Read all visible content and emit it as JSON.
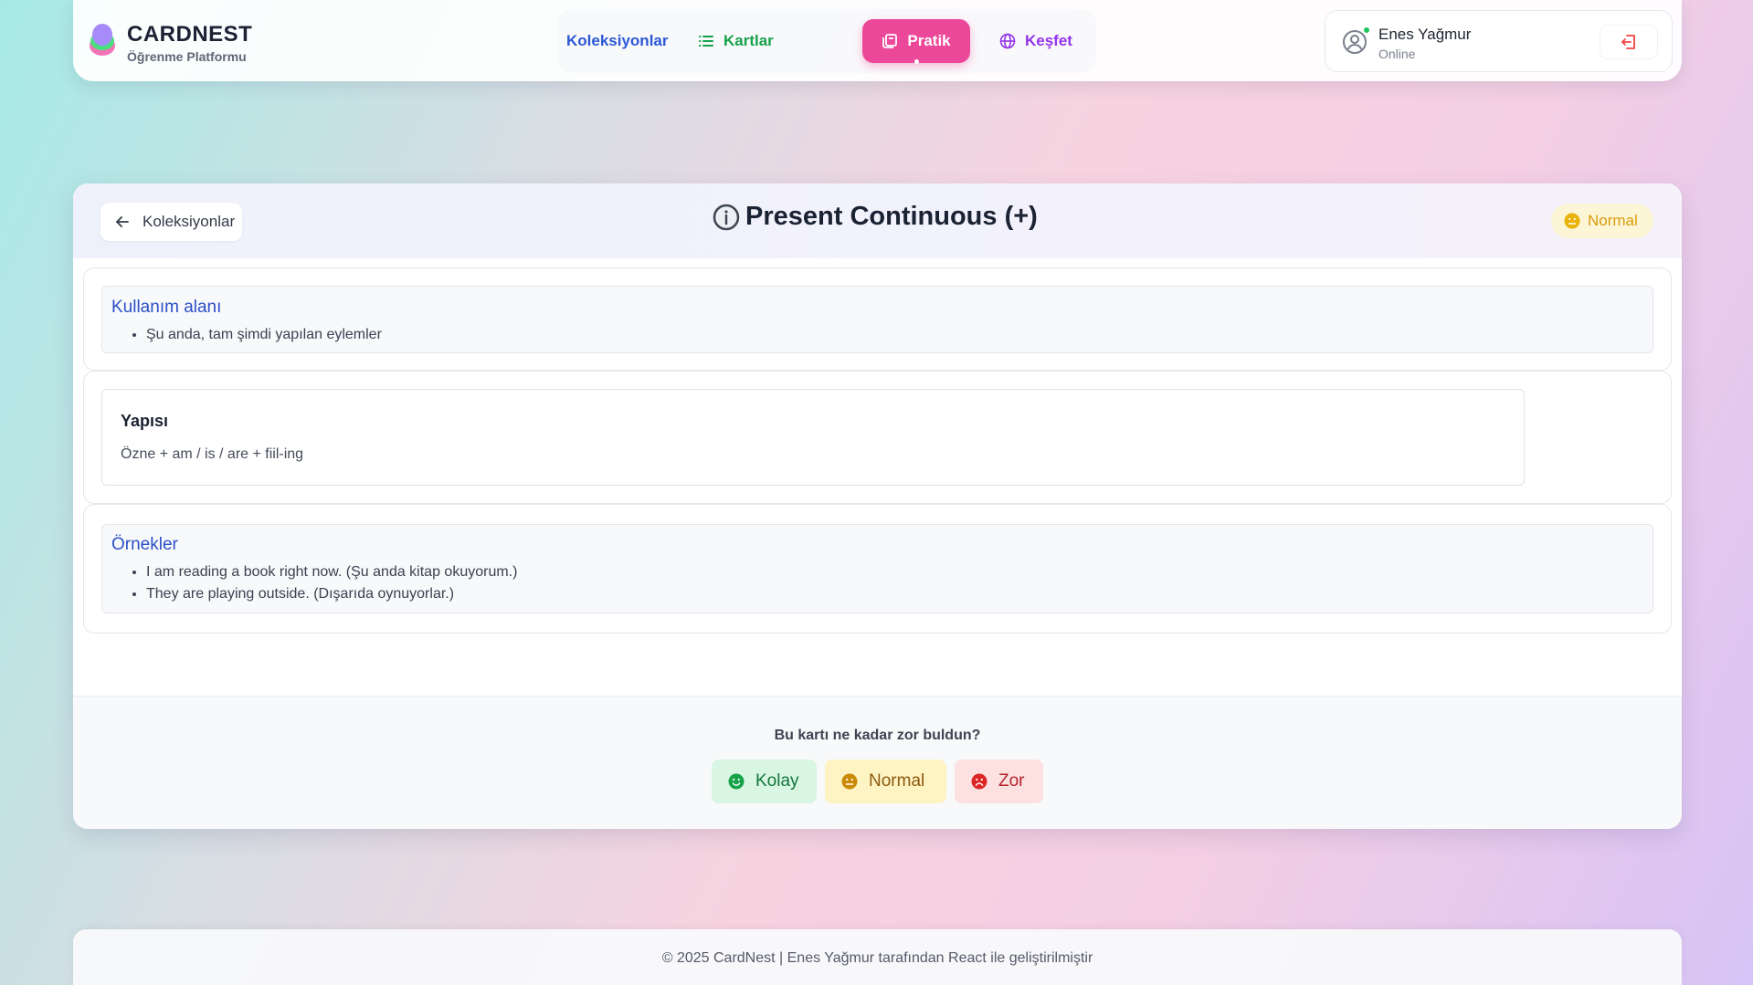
{
  "brand": {
    "title": "CARDNEST",
    "subtitle": "Öğrenme Platformu"
  },
  "nav": [
    {
      "label": "Koleksiyonlar",
      "icon": "none",
      "color": "#2c58d6"
    },
    {
      "label": "Kartlar",
      "icon": "list-icon",
      "color": "#17a14a"
    },
    {
      "label": "Pratik",
      "icon": "cards-icon",
      "active": true,
      "color": "#ec4899"
    },
    {
      "label": "Keşfet",
      "icon": "globe-icon",
      "color": "#9333ea"
    }
  ],
  "user": {
    "name": "Enes Yağmur",
    "status": "Online"
  },
  "card": {
    "back_label": "Koleksiyonlar",
    "title": "Present Continuous (+)",
    "difficulty_badge": "Normal",
    "usage": {
      "heading": "Kullanım alanı",
      "items": [
        "Şu anda, tam şimdi yapılan eylemler"
      ]
    },
    "structure": {
      "heading": "Yapısı",
      "formula": "Özne + am / is / are + fiil-ing"
    },
    "examples": {
      "heading": "Örnekler",
      "items": [
        "I am reading a book right now. (Şu anda kitap okuyorum.)",
        "They are playing outside. (Dışarıda oynuyorlar.)"
      ]
    },
    "rating": {
      "question": "Bu kartı ne kadar zor buldun?",
      "easy": "Kolay",
      "normal": "Normal",
      "hard": "Zor"
    }
  },
  "footer": {
    "text": "© 2025 CardNest | Enes Yağmur tarafından React ile geliştirilmiştir"
  },
  "colors": {
    "accent_pink": "#ec4899",
    "easy": "#14753b",
    "normal": "#d99a0b",
    "hard": "#b4232b",
    "online": "#22c55e"
  }
}
